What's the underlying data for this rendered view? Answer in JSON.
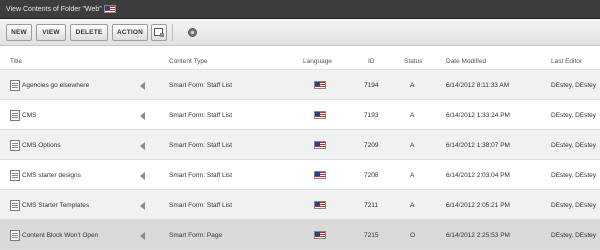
{
  "window": {
    "title": "View Contents of Folder \"Web\"",
    "language_icon": "us-flag-icon"
  },
  "toolbar": {
    "buttons": [
      "NEW",
      "VIEW",
      "DELETE",
      "ACTION"
    ],
    "extra_icons": [
      "layout-icon",
      "help-icon"
    ]
  },
  "table": {
    "columns": [
      "Title",
      "Content Type",
      "Language",
      "ID",
      "Status",
      "Date Modified",
      "Last Editor"
    ],
    "rows": [
      {
        "title": "Agencies go elsewhere",
        "type": "Smart Form: Staff List",
        "id": "7194",
        "status": "A",
        "date": "6/14/2012 8:11:33 AM",
        "editor": "DEstey, DEstey"
      },
      {
        "title": "CMS",
        "type": "Smart Form: Staff List",
        "id": "7193",
        "status": "A",
        "date": "6/14/2012 1:33:24 PM",
        "editor": "DEstey, DEstey"
      },
      {
        "title": "CMS Options",
        "type": "Smart Form: Staff List",
        "id": "7209",
        "status": "A",
        "date": "6/14/2012 1:38:07 PM",
        "editor": "DEstey, DEstey"
      },
      {
        "title": "CMS starter designs",
        "type": "Smart Form: Staff List",
        "id": "7208",
        "status": "A",
        "date": "6/14/2012 2:03:04 PM",
        "editor": "DEstey, DEstey"
      },
      {
        "title": "CMS Starter Templates",
        "type": "Smart Form: Staff List",
        "id": "7211",
        "status": "A",
        "date": "6/14/2012 2:05:21 PM",
        "editor": "DEstey, DEstey"
      },
      {
        "title": "Content Block Won't Open",
        "type": "Smart Form: Page",
        "id": "7215",
        "status": "O",
        "date": "6/14/2012 2:25:53 PM",
        "editor": "DEstey, DEstey"
      }
    ]
  }
}
